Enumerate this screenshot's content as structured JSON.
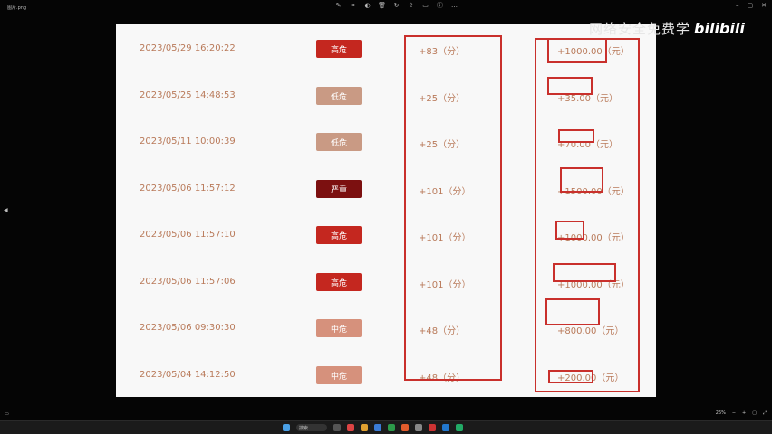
{
  "window": {
    "filename": "图片.png",
    "zoom": "26%",
    "search_placeholder": "搜索"
  },
  "watermark": {
    "text": "网络安全免费学",
    "logo": "bilibili"
  },
  "records": [
    {
      "datetime": "2023/05/29 16:20:22",
      "level": "高危",
      "points": "+83（分）",
      "amount": "+1000.00（元）",
      "level_color": "#c4271f"
    },
    {
      "datetime": "2023/05/25 14:48:53",
      "level": "低危",
      "points": "+25（分）",
      "amount": "+35.00（元）",
      "level_color": "#c99a84"
    },
    {
      "datetime": "2023/05/11 10:00:39",
      "level": "低危",
      "points": "+25（分）",
      "amount": "+70.00（元）",
      "level_color": "#c99a84"
    },
    {
      "datetime": "2023/05/06 11:57:12",
      "level": "严重",
      "points": "+101（分）",
      "amount": "+1500.00（元）",
      "level_color": "#7c1010"
    },
    {
      "datetime": "2023/05/06 11:57:10",
      "level": "高危",
      "points": "+101（分）",
      "amount": "+1000.00（元）",
      "level_color": "#c4271f"
    },
    {
      "datetime": "2023/05/06 11:57:06",
      "level": "高危",
      "points": "+101（分）",
      "amount": "+1000.00（元）",
      "level_color": "#c4271f"
    },
    {
      "datetime": "2023/05/06 09:30:30",
      "level": "中危",
      "points": "+48（分）",
      "amount": "+800.00（元）",
      "level_color": "#d6917c"
    },
    {
      "datetime": "2023/05/04 14:12:50",
      "level": "中危",
      "points": "+48（分）",
      "amount": "+200.00（元）",
      "level_color": "#d6917c"
    }
  ],
  "colors": {
    "annotation": "#c9302c",
    "text": "#b97a5a",
    "paper": "#f8f8f8"
  }
}
